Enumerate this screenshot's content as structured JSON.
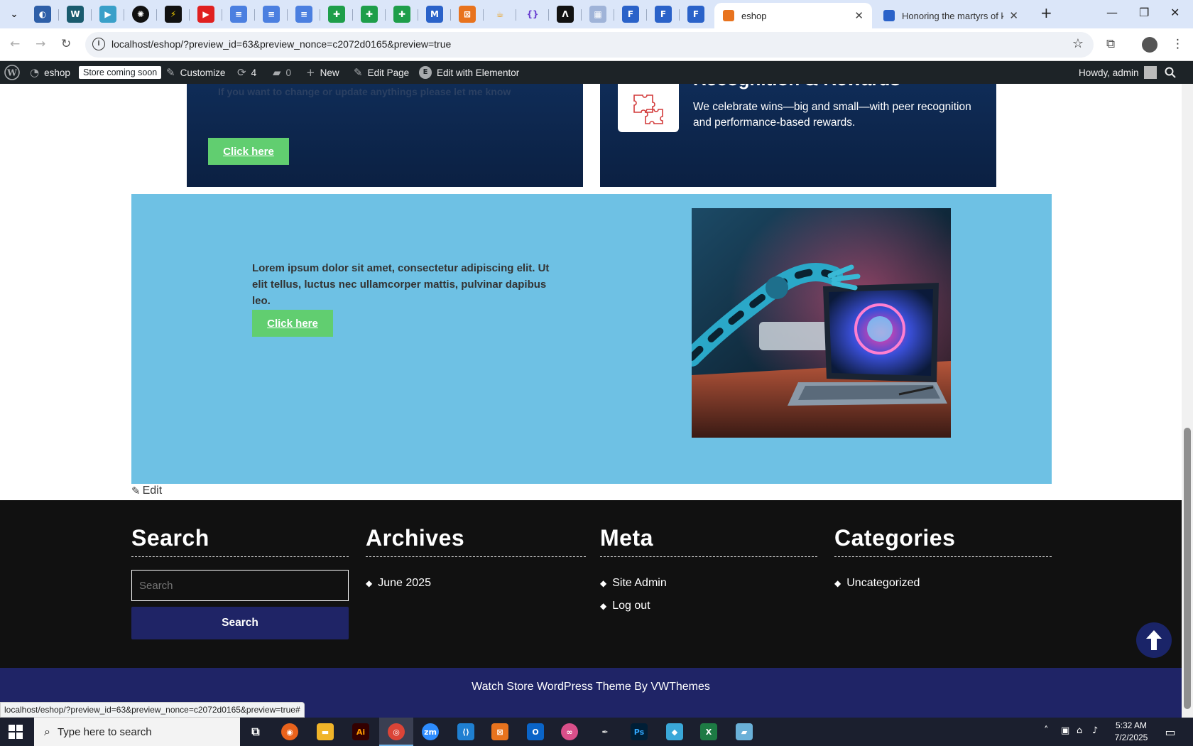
{
  "browser": {
    "tabs": [
      {
        "title": "eshop",
        "active": true
      },
      {
        "title": "Honoring the martyrs of karbala",
        "active": false
      }
    ],
    "new_tab": "+",
    "url": "localhost/eshop/?preview_id=63&preview_nonce=c2072d0165&preview=true",
    "status_url": "localhost/eshop/?preview_id=63&preview_nonce=c2072d0165&preview=true#"
  },
  "admin_bar": {
    "site": "eshop",
    "badge": "Store coming soon",
    "customize": "Customize",
    "updates": "4",
    "comments": "0",
    "new": "New",
    "edit_page": "Edit Page",
    "elementor": "Edit with Elementor",
    "howdy": "Howdy, admin"
  },
  "panels": {
    "left_text": "If you want to change or update anythings please let me know",
    "left_button": "Click here",
    "right_heading": "Recognition & Rewards",
    "right_desc": "We celebrate wins—big and small—with peer recognition and performance-based rewards."
  },
  "blue_section": {
    "text": "Lorem ipsum dolor sit amet, consectetur adipiscing elit. Ut elit tellus, luctus nec ullamcorper mattis, pulvinar dapibus leo.",
    "button": "Click here"
  },
  "edit_link": "Edit",
  "footer": {
    "search": {
      "heading": "Search",
      "placeholder": "Search",
      "button": "Search"
    },
    "archives": {
      "heading": "Archives",
      "items": [
        "June 2025"
      ]
    },
    "meta": {
      "heading": "Meta",
      "items": [
        "Site Admin",
        "Log out"
      ]
    },
    "categories": {
      "heading": "Categories",
      "items": [
        "Uncategorized"
      ]
    },
    "copyright": "Watch Store WordPress Theme By VWThemes"
  },
  "taskbar": {
    "search_placeholder": "Type here to search",
    "time": "5:32 AM",
    "date": "7/2/2025"
  },
  "colors": {
    "accent_green": "#61ce70",
    "section_blue": "#6ec1e4",
    "navy": "#1f2466",
    "panel_navy": "#0f2c57"
  }
}
